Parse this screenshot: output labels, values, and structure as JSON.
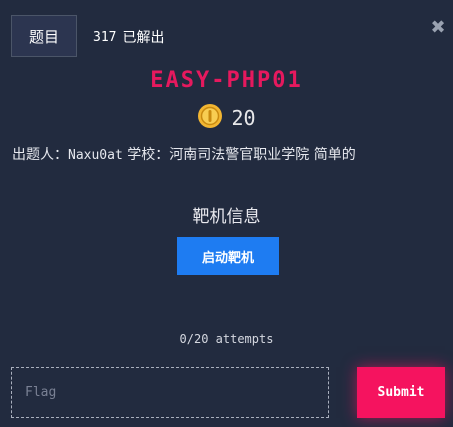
{
  "header": {
    "tab_label": "题目",
    "solves_count": "317",
    "solves_label": "已解出",
    "close_icon": "close-icon"
  },
  "challenge": {
    "title": "EASY-PHP01",
    "points": "20",
    "points_icon": "coin-icon",
    "author_label": "出题人：",
    "author": "Naxu0at",
    "school_label": "学校：",
    "school": "河南司法警官职业学院",
    "difficulty": "简单的"
  },
  "target": {
    "heading": "靶机信息",
    "start_button": "启动靶机"
  },
  "submission": {
    "attempts": "0/20 attempts",
    "flag_placeholder": "Flag",
    "flag_value": "",
    "submit_label": "Submit"
  },
  "colors": {
    "background": "#222b3f",
    "title": "#e6195e",
    "primary_button": "#1e7cf2",
    "submit_button": "#f5135f",
    "coin": "#f2b632"
  }
}
